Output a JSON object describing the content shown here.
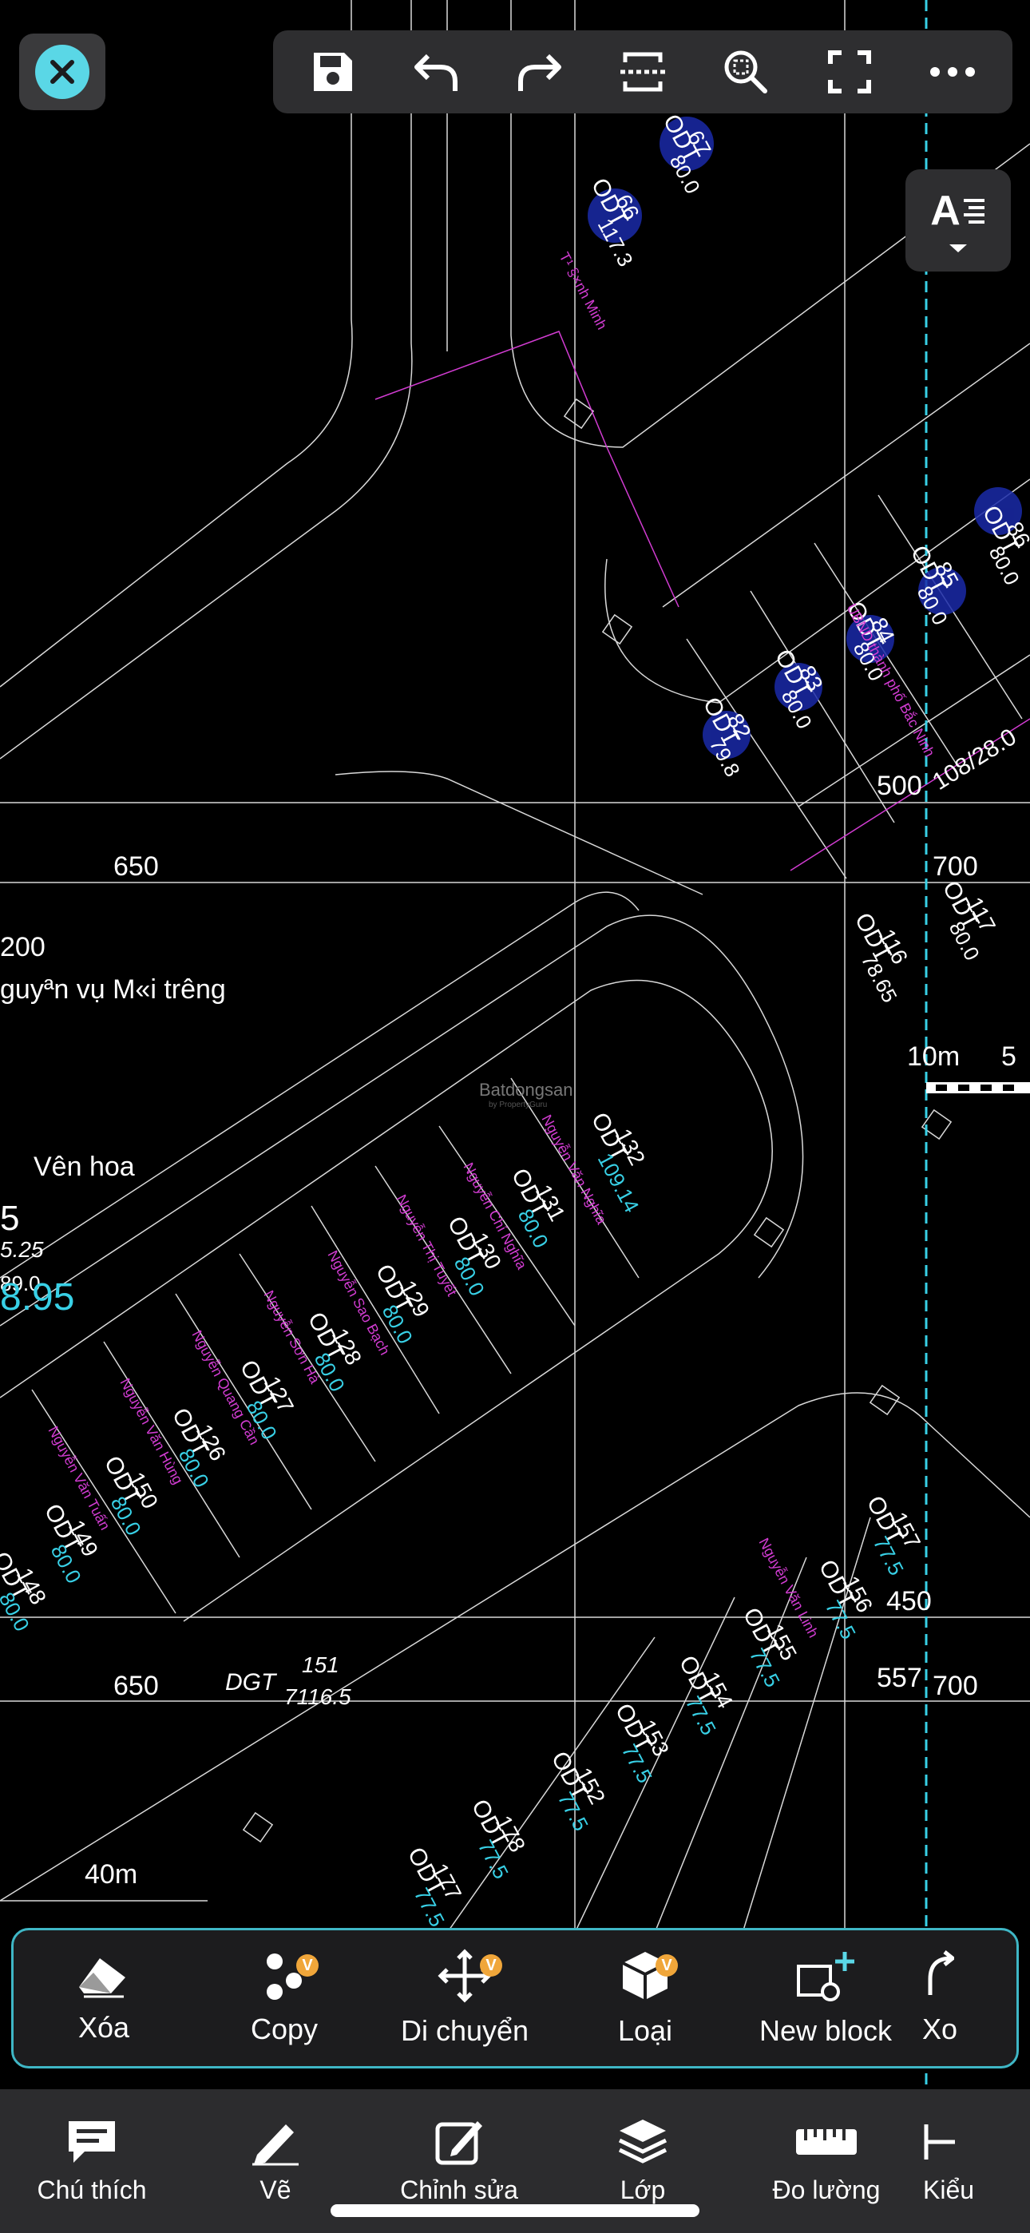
{
  "drawing": {
    "dim_labels": [
      "650",
      "650",
      "700",
      "700",
      "200",
      "500",
      "450",
      "40m",
      "10m",
      "5",
      "557"
    ],
    "text_notes": [
      "guyªn vụ M«i tr­êng",
      "V­ên hoa",
      "DGT",
      "151",
      "7116.5",
      "108/28.0",
      "5.25",
      "89.0",
      "8.95",
      "5"
    ],
    "parcels": [
      {
        "code": "ODT",
        "num": "66",
        "area": "117.3"
      },
      {
        "code": "ODT",
        "num": "67",
        "area": "80.0"
      },
      {
        "code": "ODT",
        "num": "82",
        "area": "79.8"
      },
      {
        "code": "ODT",
        "num": "83",
        "area": "80.0"
      },
      {
        "code": "ODT",
        "num": "84",
        "area": "80.0"
      },
      {
        "code": "ODT",
        "num": "85",
        "area": "80.0"
      },
      {
        "code": "ODT",
        "num": "86",
        "area": "80.0"
      },
      {
        "code": "ODT",
        "num": "116",
        "area": "78.65"
      },
      {
        "code": "ODT",
        "num": "117",
        "area": "80.0"
      },
      {
        "code": "ODT",
        "num": "132",
        "area": "109.14"
      },
      {
        "code": "ODT",
        "num": "131",
        "area": "80.0"
      },
      {
        "code": "ODT",
        "num": "130",
        "area": "80.0"
      },
      {
        "code": "ODT",
        "num": "129",
        "area": "80.0"
      },
      {
        "code": "ODT",
        "num": "128",
        "area": "80.0"
      },
      {
        "code": "ODT",
        "num": "127",
        "area": "80.0"
      },
      {
        "code": "ODT",
        "num": "126",
        "area": "80.0"
      },
      {
        "code": "ODT",
        "num": "150",
        "area": "80.0"
      },
      {
        "code": "ODT",
        "num": "149",
        "area": "80.0"
      },
      {
        "code": "ODT",
        "num": "148",
        "area": "80.0"
      },
      {
        "code": "ODT",
        "num": "157",
        "area": "77.5"
      },
      {
        "code": "ODT",
        "num": "156",
        "area": "77.5"
      },
      {
        "code": "ODT",
        "num": "155",
        "area": "77.5"
      },
      {
        "code": "ODT",
        "num": "154",
        "area": "77.5"
      },
      {
        "code": "ODT",
        "num": "153",
        "area": "77.5"
      },
      {
        "code": "ODT",
        "num": "152",
        "area": "77.5"
      },
      {
        "code": "ODT",
        "num": "178",
        "area": "77.5"
      },
      {
        "code": "ODT",
        "num": "177",
        "area": "77.5"
      }
    ],
    "owner_names": [
      "Nguyễn Văn Nghĩa",
      "Nguyễn Chí Nghĩa",
      "Nguyễn Thị Tuyết",
      "Nguyễn Sao Bạch",
      "Nguyễn Sơn Hà",
      "Nguyễn Quang Cần",
      "Nguyễn Văn Hùng",
      "Nguyễn Văn Tuấn",
      "Nguyễn Văn Linh",
      "UBND thành phố Bắc Ninh",
      "T¹ §×nh Minh"
    ],
    "watermark": "Batdongsan",
    "watermark_sub": "by PropertyGuru"
  },
  "toolbar": {
    "close": "close",
    "buttons": [
      "save-icon",
      "undo-icon",
      "redo-icon",
      "crop-icon",
      "zoom-icon",
      "fullscreen-icon",
      "more-icon"
    ],
    "text_style_label": "A"
  },
  "action_bar": {
    "items": [
      {
        "label": "Xóa",
        "icon": "eraser-icon",
        "badge": ""
      },
      {
        "label": "Copy",
        "icon": "copy-icon",
        "badge": "V"
      },
      {
        "label": "Di chuyển",
        "icon": "move-icon",
        "badge": "V"
      },
      {
        "label": "Loại",
        "icon": "cube-icon",
        "badge": "V"
      },
      {
        "label": "New block",
        "icon": "new-block-icon",
        "badge": ""
      },
      {
        "label": "Xo",
        "icon": "rotate-icon",
        "badge": ""
      }
    ]
  },
  "tab_bar": {
    "items": [
      {
        "label": "Chú thích",
        "icon": "comment-icon"
      },
      {
        "label": "Vẽ",
        "icon": "pencil-icon"
      },
      {
        "label": "Chỉnh sửa",
        "icon": "edit-icon"
      },
      {
        "label": "Lớp",
        "icon": "layers-icon"
      },
      {
        "label": "Đo lường",
        "icon": "ruler-icon"
      },
      {
        "label": "Kiểu",
        "icon": "dimension-icon"
      }
    ]
  },
  "colors": {
    "accent": "#5ad7e6",
    "cad_line": "#ffffff",
    "cad_magenta": "#d23cd2",
    "cad_cyan": "#38d0e6",
    "badge": "#f0a63a"
  }
}
